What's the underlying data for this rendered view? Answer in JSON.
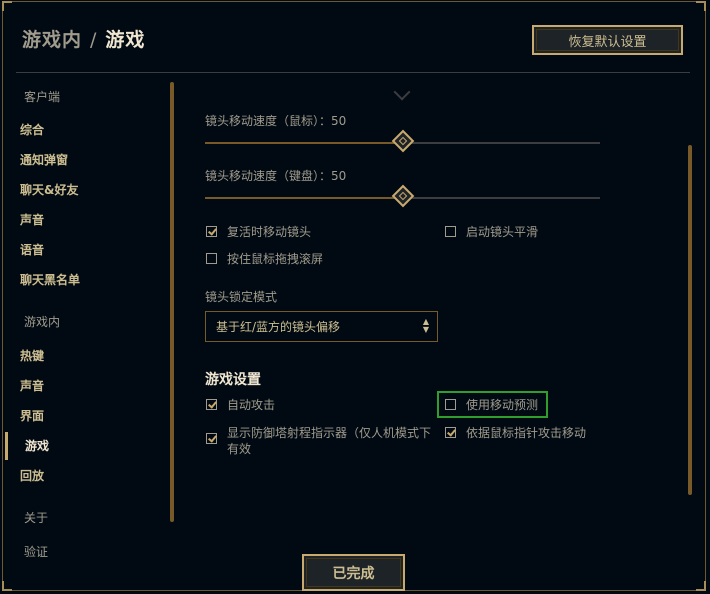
{
  "header": {
    "breadcrumb_parent": "游戏内",
    "separator": "/",
    "breadcrumb_current": "游戏",
    "reset_label": "恢复默认设置"
  },
  "sidebar": {
    "groups": [
      {
        "title": "客户端",
        "items": [
          "综合",
          "通知弹窗",
          "聊天&好友",
          "声音",
          "语音",
          "聊天黑名单"
        ]
      },
      {
        "title": "游戏内",
        "items": [
          "热键",
          "声音",
          "界面",
          "游戏",
          "回放"
        ]
      },
      {
        "title": "关于",
        "items": [
          "验证"
        ]
      }
    ],
    "active_item": "游戏"
  },
  "camera": {
    "mouse_speed_label": "镜头移动速度（鼠标）：50",
    "mouse_speed_value": 50,
    "keyboard_speed_label": "镜头移动速度（键盘）：50",
    "keyboard_speed_value": 50,
    "options": [
      {
        "label": "复活时移动镜头",
        "checked": true
      },
      {
        "label": "启动镜头平滑",
        "checked": false
      },
      {
        "label": "按住鼠标拖拽滚屏",
        "checked": false
      }
    ],
    "lock_mode_label": "镜头锁定模式",
    "lock_mode_value": "基于红/蓝方的镜头偏移"
  },
  "game_settings": {
    "title": "游戏设置",
    "options": [
      {
        "label": "自动攻击",
        "checked": true
      },
      {
        "label": "使用移动预测",
        "checked": false
      },
      {
        "label": "显示防御塔射程指示器（仅人机模式下有效",
        "checked": true
      },
      {
        "label": "依据鼠标指针攻击移动",
        "checked": true
      }
    ]
  },
  "footer": {
    "done_label": "已完成"
  },
  "colors": {
    "background": "#010a13",
    "gold": "#c8aa6e",
    "text": "#a09b8c",
    "highlight": "#2f9e2f"
  }
}
